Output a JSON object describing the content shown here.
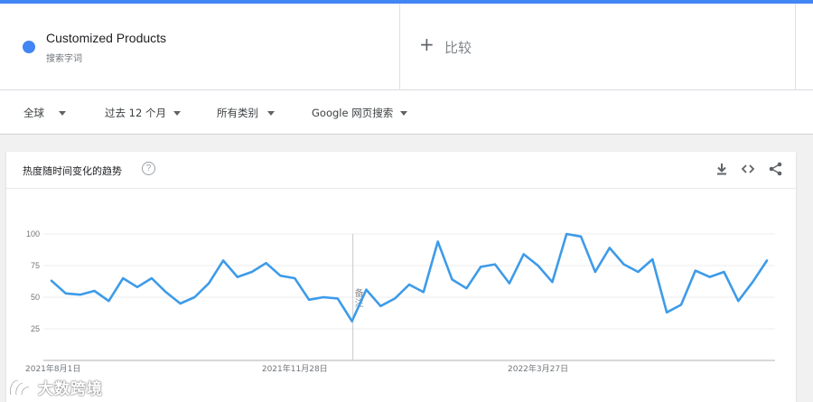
{
  "search_term": {
    "name": "Customized Products",
    "type_label": "搜索字词",
    "color": "#4285f4"
  },
  "compare": {
    "label": "比较"
  },
  "filters": [
    {
      "label": "全球"
    },
    {
      "label": "过去 12 个月"
    },
    {
      "label": "所有类别"
    },
    {
      "label": "Google 网页搜索"
    }
  ],
  "card": {
    "title": "热度随时间变化的趋势",
    "help": "?",
    "tools": [
      "download-icon",
      "embed-icon",
      "share-icon"
    ]
  },
  "watermark": {
    "text": "大数跨境"
  },
  "chart_data": {
    "type": "line",
    "title": "",
    "xlabel": "",
    "ylabel": "",
    "ylim": [
      0,
      100
    ],
    "yticks": [
      25,
      50,
      75,
      100
    ],
    "x_tick_labels": [
      "2021年8月1日",
      "2021年11月28日",
      "2022年3月27日"
    ],
    "annotation": "备注",
    "line_color": "#3d9be9",
    "grid": true,
    "series": [
      {
        "values": [
          63,
          53,
          52,
          55,
          47,
          65,
          58,
          65,
          54,
          45,
          50,
          61,
          79,
          66,
          70,
          77,
          67,
          65,
          48,
          50,
          49,
          31,
          56,
          43,
          49,
          60,
          54,
          94,
          64,
          57,
          74,
          76,
          61,
          84,
          75,
          62,
          100,
          98,
          70,
          89,
          76,
          70,
          80,
          38,
          44,
          71,
          66,
          70,
          47,
          62,
          79
        ]
      }
    ]
  }
}
